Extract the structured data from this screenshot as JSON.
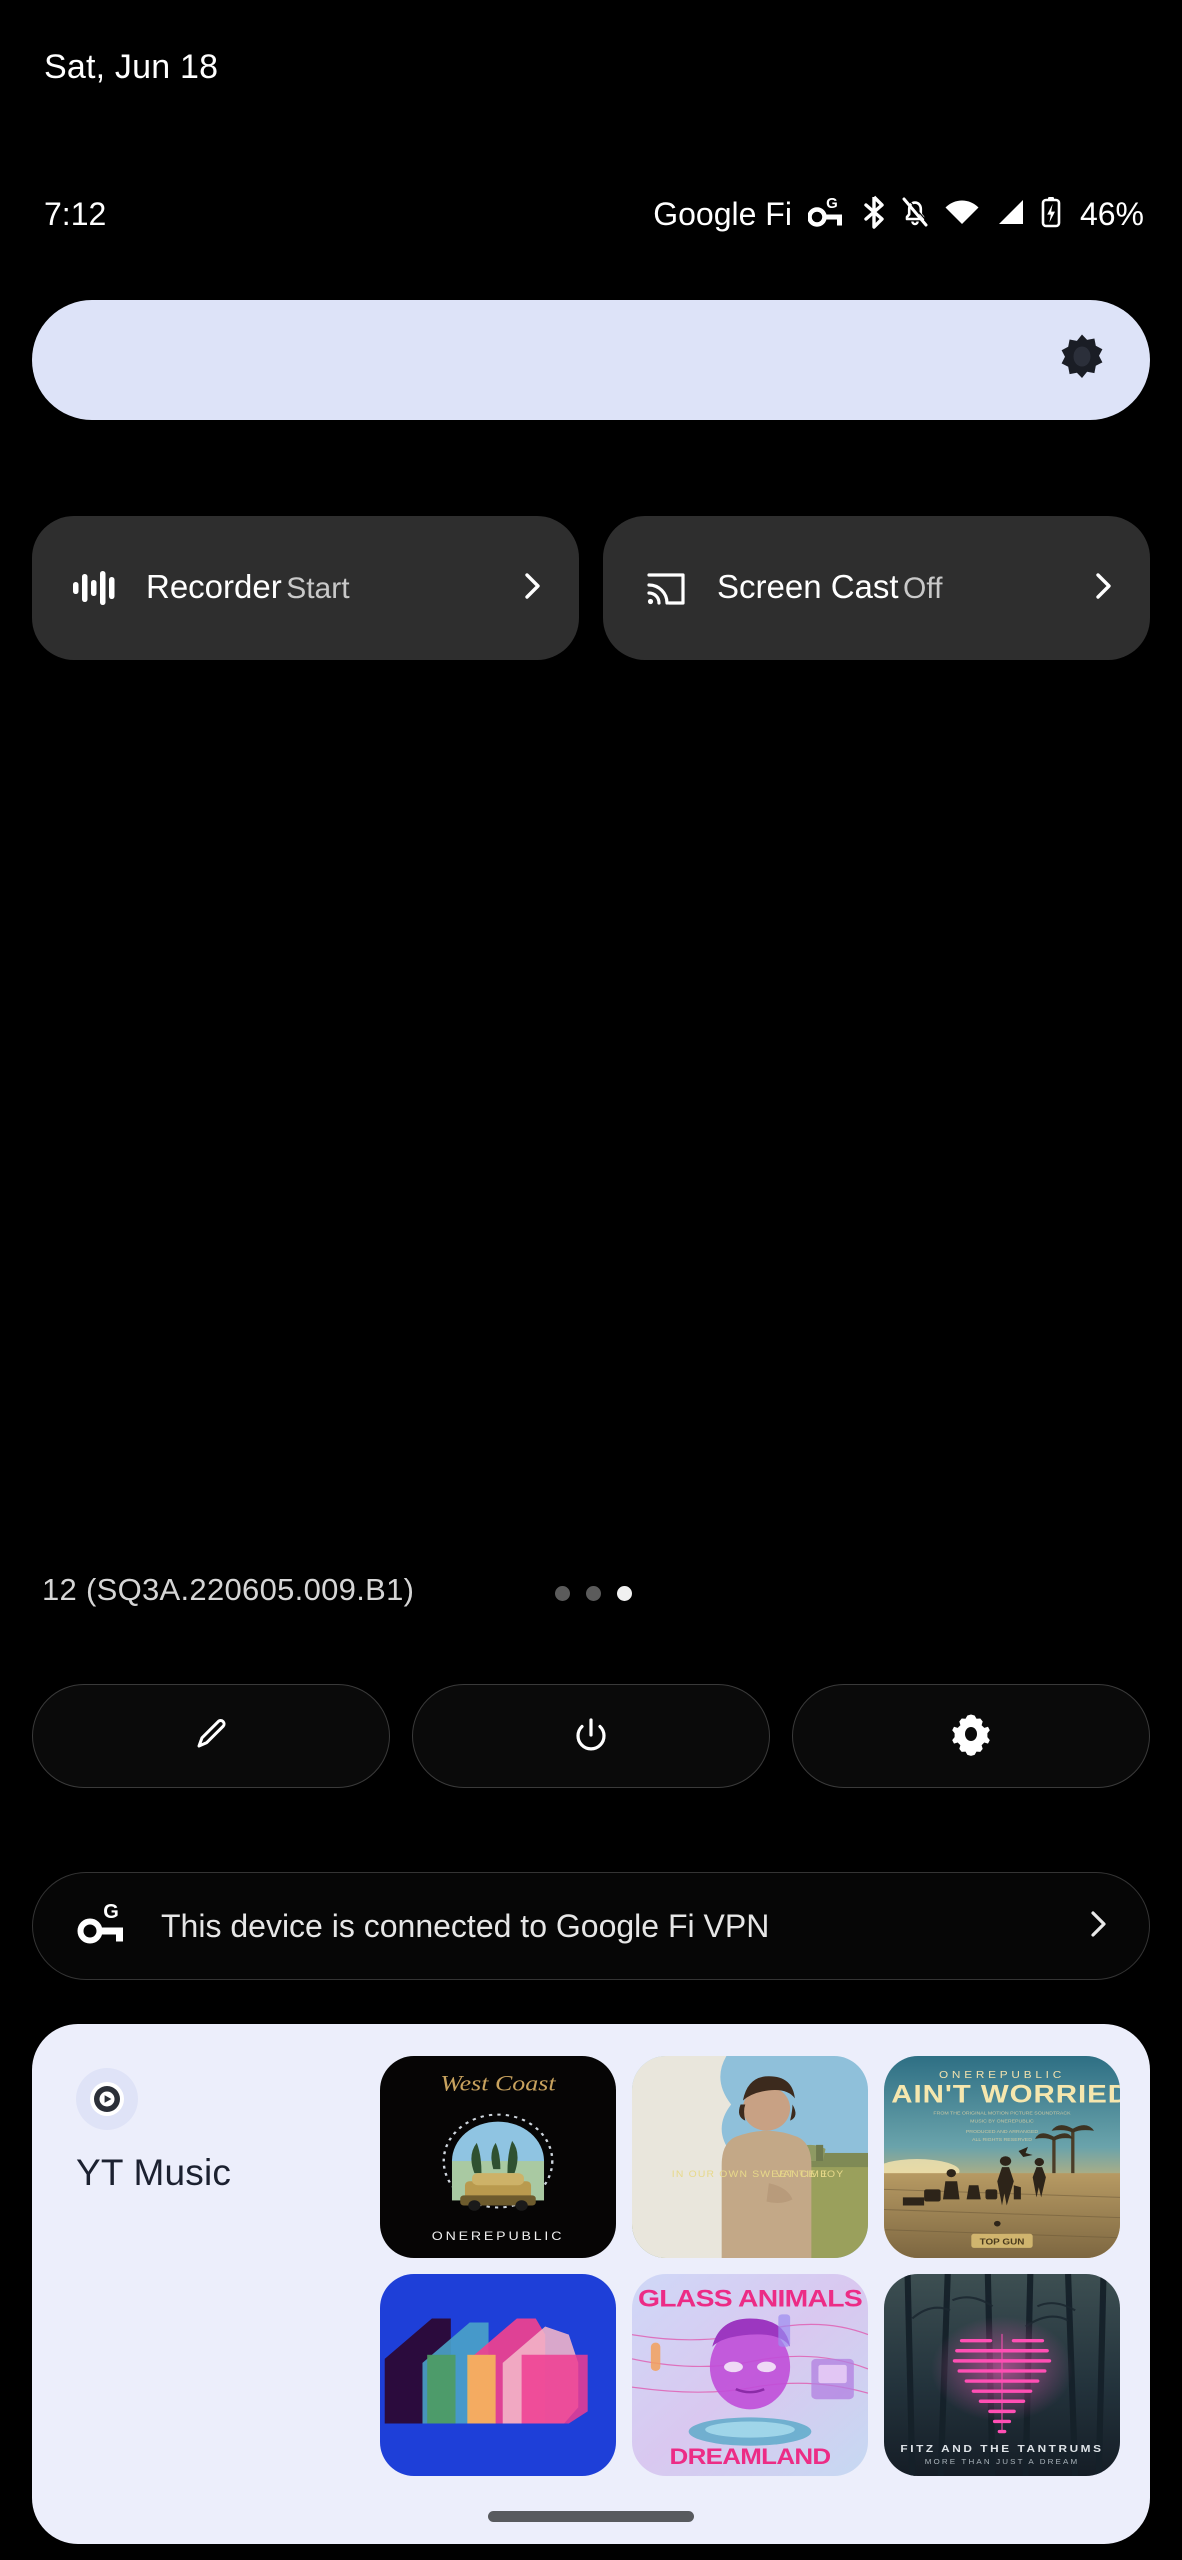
{
  "statusbar": {
    "date": "Sat, Jun 18",
    "clock": "7:12",
    "carrier": "Google Fi",
    "battery_percent": "46%",
    "icons": [
      "vpn-key-google-icon",
      "bluetooth-icon",
      "notifications-off-icon",
      "wifi-icon",
      "cell-signal-icon",
      "battery-charging-icon"
    ]
  },
  "brightness": {
    "icon": "brightness-icon",
    "level_percent": 100,
    "track_color": "#dde3f8"
  },
  "tiles": [
    {
      "title": "Recorder",
      "subtitle": "Start",
      "icon": "audio-waveform-icon",
      "chevron": "chevron-right-icon"
    },
    {
      "title": "Screen Cast",
      "subtitle": "Off",
      "icon": "cast-icon",
      "chevron": "chevron-right-icon"
    }
  ],
  "footer": {
    "build": "12 (SQ3A.220605.009.B1)",
    "pages": 3,
    "active_page": 3
  },
  "actions": [
    {
      "name": "edit-button",
      "icon": "pencil-icon"
    },
    {
      "name": "power-button",
      "icon": "power-icon"
    },
    {
      "name": "settings-button",
      "icon": "gear-icon"
    }
  ],
  "vpn": {
    "icon": "vpn-key-google-icon",
    "text": "This device is connected to Google Fi VPN",
    "chevron": "chevron-right-icon"
  },
  "media": {
    "app_name": "YT Music",
    "app_icon": "yt-music-play-icon",
    "panel_color": "#eceefb",
    "albums": [
      {
        "title": "West Coast",
        "artist": "ONEREPUBLIC",
        "art": "west-coast-onerepublic"
      },
      {
        "title": "In Our Own Sweet Time",
        "artist": "VANCE JOY",
        "art": "in-our-own-sweet-time-vance-joy"
      },
      {
        "title": "I AIN'T WORRIED",
        "artist": "ONEREPUBLIC",
        "art": "i-aint-worried-onerepublic"
      },
      {
        "title": "",
        "artist": "",
        "art": "blue-thumbs-abstract"
      },
      {
        "title": "DREAMLAND",
        "artist": "GLASS ANIMALS",
        "art": "dreamland-glass-animals"
      },
      {
        "title": "MORE THAN JUST A DREAM",
        "artist": "FITZ AND THE TANTRUMS",
        "art": "more-than-just-a-dream-fitz"
      }
    ]
  }
}
